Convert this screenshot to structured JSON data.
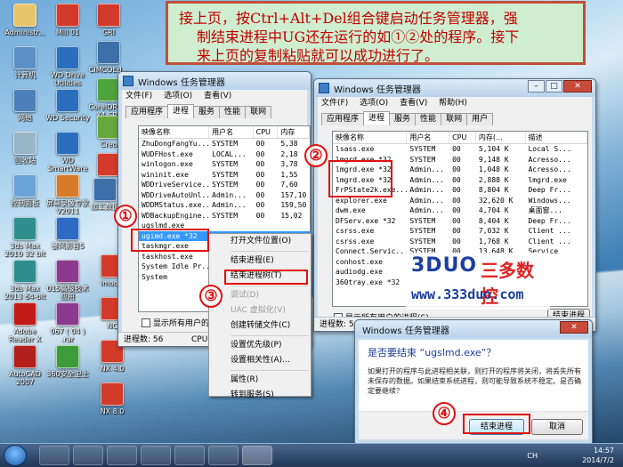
{
  "note": {
    "line1": "接上页，按Ctrl+Alt+Del组合键启动任务管理器，强",
    "line2": "制结束进程中UG还在运行的如①②处的程序。接下",
    "line3": "来上页的复制粘贴就可以成功进行了。"
  },
  "desktop_icons": [
    {
      "label": "Administr...",
      "icon": "user-folder-icon",
      "color": "#e8c56a"
    },
    {
      "label": "计算机",
      "icon": "computer-icon",
      "color": "#5c8fc6"
    },
    {
      "label": "网络",
      "icon": "network-icon",
      "color": "#4d7fb8"
    },
    {
      "label": "回收站",
      "icon": "recycle-bin-icon",
      "color": "#9ab4c8"
    },
    {
      "label": "控制面板",
      "icon": "control-panel-icon",
      "color": "#6aa3d6"
    },
    {
      "label": "3ds Max 2010 32 bit",
      "icon": "3ds-max-icon",
      "color": "#2f8f8f"
    },
    {
      "label": "3ds Max 2013 64-bit",
      "icon": "3ds-max-icon",
      "color": "#2f8f8f"
    },
    {
      "label": "Adobe Reader X",
      "icon": "adobe-reader-icon",
      "color": "#c21b17"
    },
    {
      "label": "AutoCAD 2007",
      "icon": "autocad-icon",
      "color": "#b3201c"
    },
    {
      "label": "Mill 01",
      "icon": "mill-icon",
      "color": "#d23a2a"
    },
    {
      "label": "WD Drive Utilities",
      "icon": "wd-icon",
      "color": "#2a6fbd"
    },
    {
      "label": "WD Security",
      "icon": "wd-icon",
      "color": "#2a6fbd"
    },
    {
      "label": "WD SmartWare",
      "icon": "wd-icon",
      "color": "#2a6fbd"
    },
    {
      "label": "屏幕录像专家 V2011",
      "icon": "recorder-icon",
      "color": "#d77b2a"
    },
    {
      "label": "暴风影音5",
      "icon": "player-icon",
      "color": "#2e6bc4"
    },
    {
      "label": "015高级技术应用",
      "icon": "rar-icon",
      "color": "#8b3a8f"
    },
    {
      "label": "067 ( 04 ) .rar",
      "icon": "rar-icon",
      "color": "#8b3a8f"
    },
    {
      "label": "360安全卫士",
      "icon": "360-icon",
      "color": "#3d9c3a"
    },
    {
      "label": "GRI",
      "icon": "nx-icon",
      "color": "#d23a2a"
    },
    {
      "label": "CIMCOEd...",
      "icon": "cimco-icon",
      "color": "#3d6fa8"
    },
    {
      "label": "CorelDRAW X4 SP2",
      "icon": "coreldraw-icon",
      "color": "#4fa33d"
    },
    {
      "label": "Creo",
      "icon": "creo-icon",
      "color": "#66a83c"
    },
    {
      "label": "ENG",
      "icon": "nx-icon",
      "color": "#d23a2a"
    },
    {
      "label": "imools",
      "icon": "nx-icon",
      "color": "#d23a2a"
    },
    {
      "label": "NC",
      "icon": "nx-icon",
      "color": "#d23a2a"
    },
    {
      "label": "NX 4.0",
      "icon": "nx-icon",
      "color": "#d23a2a"
    },
    {
      "label": "NX 8.0",
      "icon": "nx-icon",
      "color": "#d23a2a"
    },
    {
      "label": "加工数据",
      "icon": "cimco-icon",
      "color": "#3d6fa8"
    }
  ],
  "tm_left": {
    "title": "Windows 任务管理器",
    "menu": [
      "文件(F)",
      "选项(O)",
      "查看(V)"
    ],
    "tabs": [
      "应用程序",
      "进程",
      "服务",
      "性能",
      "联网"
    ],
    "headers": [
      "映像名称",
      "用户名",
      "CPU",
      "内存"
    ],
    "rows": [
      [
        "ZhuDongFangYu...",
        "SYSTEM",
        "00",
        "5,38"
      ],
      [
        "WUDFHost.exe",
        "LOCAL...",
        "00",
        "2,18"
      ],
      [
        "winlogon.exe",
        "SYSTEM",
        "00",
        "3,78"
      ],
      [
        "wininit.exe",
        "SYSTEM",
        "00",
        "1,55"
      ],
      [
        "WDDriveService...",
        "SYSTEM",
        "00",
        "7,60"
      ],
      [
        "WDDriveAutoUnl...",
        "Admin...",
        "00",
        "157,10"
      ],
      [
        "WDDMStatus.exe...",
        "Admin...",
        "00",
        "159,50"
      ],
      [
        "WDBackupEngine...",
        "SYSTEM",
        "00",
        "15,02"
      ],
      [
        "ugslmd.exe",
        "",
        "",
        ""
      ],
      [
        "ugimd.exe *32",
        "",
        "",
        ""
      ],
      [
        "taskmgr.exe",
        "",
        "",
        ""
      ],
      [
        "taskhost.exe",
        "",
        "",
        ""
      ],
      [
        "System Idle Pr...",
        "",
        "",
        ""
      ],
      [
        "System",
        "",
        "",
        ""
      ]
    ],
    "show_all_label": "显示所有用户的",
    "status": "进程数: 56",
    "status_cpu": "CPU"
  },
  "context_menu": {
    "items": [
      "打开文件位置(O)",
      "结束进程(E)",
      "结束进程树(T)",
      "调试(D)",
      "UAC 虚拟化(V)",
      "创建转储文件(C)",
      "设置优先级(P)",
      "设置相关性(A)...",
      "属性(R)",
      "转到服务(S)"
    ]
  },
  "tm_right": {
    "title": "Windows 任务管理器",
    "menu": [
      "文件(F)",
      "选项(O)",
      "查看(V)",
      "帮助(H)"
    ],
    "tabs": [
      "应用程序",
      "进程",
      "服务",
      "性能",
      "联网",
      "用户"
    ],
    "headers": [
      "映像名称",
      "用户名",
      "CPU",
      "内存(...",
      "描述"
    ],
    "rows": [
      [
        "lsass.exe",
        "SYSTEM",
        "00",
        "5,104 K",
        "Local S..."
      ],
      [
        "lmgrd.exe *32",
        "SYSTEM",
        "00",
        "9,148 K",
        "Acresso..."
      ],
      [
        "lmgrd.exe *32",
        "Admin...",
        "00",
        "1,048 K",
        "Acresso..."
      ],
      [
        "lmgrd.exe *32",
        "Admin...",
        "00",
        "2,888 K",
        "lmgrd.exe"
      ],
      [
        "FrPState2k.exe...",
        "Admin...",
        "00",
        "8,804 K",
        "Deep Fr..."
      ],
      [
        "explorer.exe",
        "Admin...",
        "00",
        "32,620 K",
        "Windows..."
      ],
      [
        "dwm.exe",
        "Admin...",
        "00",
        "4,704 K",
        "桌面窗..."
      ],
      [
        "DFServ.exe *32",
        "SYSTEM",
        "00",
        "8,404 K",
        "Deep Fr..."
      ],
      [
        "csrss.exe",
        "SYSTEM",
        "00",
        "7,032 K",
        "Client ..."
      ],
      [
        "csrss.exe",
        "SYSTEM",
        "00",
        "1,768 K",
        "Client ..."
      ],
      [
        "Connect.Servic...",
        "SYSTEM",
        "00",
        "13,648 K",
        "Service"
      ],
      [
        "conhost.exe",
        "",
        "",
        "",
        ""
      ],
      [
        "audiodg.exe",
        "",
        "",
        "",
        ""
      ],
      [
        "360tray.exe *32",
        "",
        "",
        "",
        ""
      ]
    ],
    "show_all_label": "显示所有用户的进程(S)",
    "end_button": "结束进程(E)",
    "status": "进程数: 56"
  },
  "dialog": {
    "title": "Windows 任务管理器",
    "question": "是否要结束 “ugslmd.exe”？",
    "message": "如果打开的程序与此进程相关联，则打开的程序将关闭，将丢失所有未保存的数据。如果结束系统进程，则可能导致系统不稳定。是否确定要继续？",
    "ok": "结束进程",
    "cancel": "取消"
  },
  "markers": [
    "①",
    "②",
    "③",
    "④"
  ],
  "watermark": {
    "brand": "3DUO",
    "brand_cn": "三多数控",
    "url": "www.333duo.com"
  },
  "taskbar": {
    "time": "14:57",
    "date": "2014/7/2",
    "lang": "CH"
  }
}
